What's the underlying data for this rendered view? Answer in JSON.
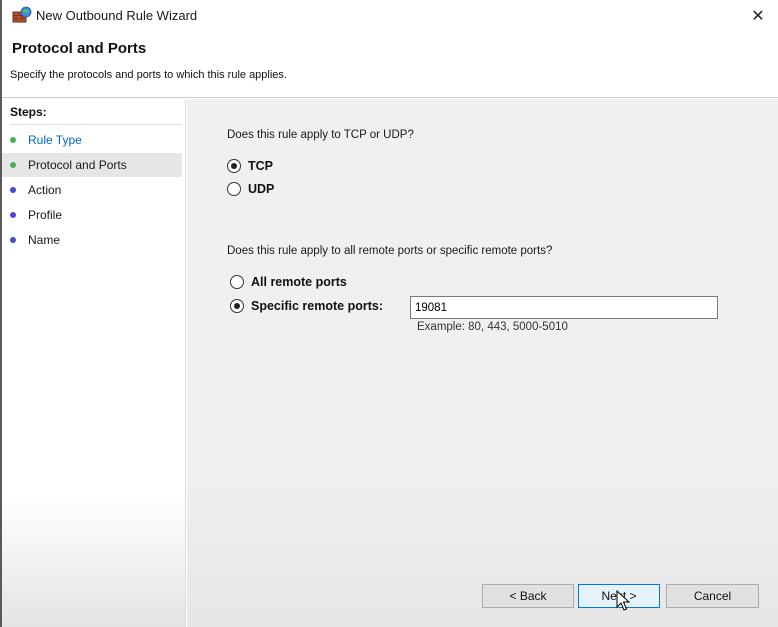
{
  "window": {
    "title": "New Outbound Rule Wizard",
    "close_glyph": "✕",
    "icon": "firewall-rule-icon"
  },
  "header": {
    "title": "Protocol and Ports",
    "description": "Specify the protocols and ports to which this rule applies."
  },
  "sidebar": {
    "steps_label": "Steps:",
    "items": [
      {
        "label": "Rule Type",
        "state": "completed",
        "dot_color": "#4caf50"
      },
      {
        "label": "Protocol and Ports",
        "state": "current",
        "dot_color": "#4caf50"
      },
      {
        "label": "Action",
        "state": "pending",
        "dot_color": "#4a4ad0"
      },
      {
        "label": "Profile",
        "state": "pending",
        "dot_color": "#4a4ad0"
      },
      {
        "label": "Name",
        "state": "pending",
        "dot_color": "#4a4ad0"
      }
    ]
  },
  "protocol": {
    "question": "Does this rule apply to TCP or UDP?",
    "options": [
      {
        "label": "TCP",
        "selected": true
      },
      {
        "label": "UDP",
        "selected": false
      }
    ]
  },
  "ports": {
    "question": "Does this rule apply to all remote ports or specific remote ports?",
    "options": [
      {
        "label": "All remote ports",
        "selected": false
      },
      {
        "label": "Specific remote ports:",
        "selected": true
      }
    ],
    "value": "19081",
    "example": "Example: 80, 443, 5000-5010"
  },
  "buttons": {
    "back": "< Back",
    "next": "Next >",
    "cancel": "Cancel"
  }
}
